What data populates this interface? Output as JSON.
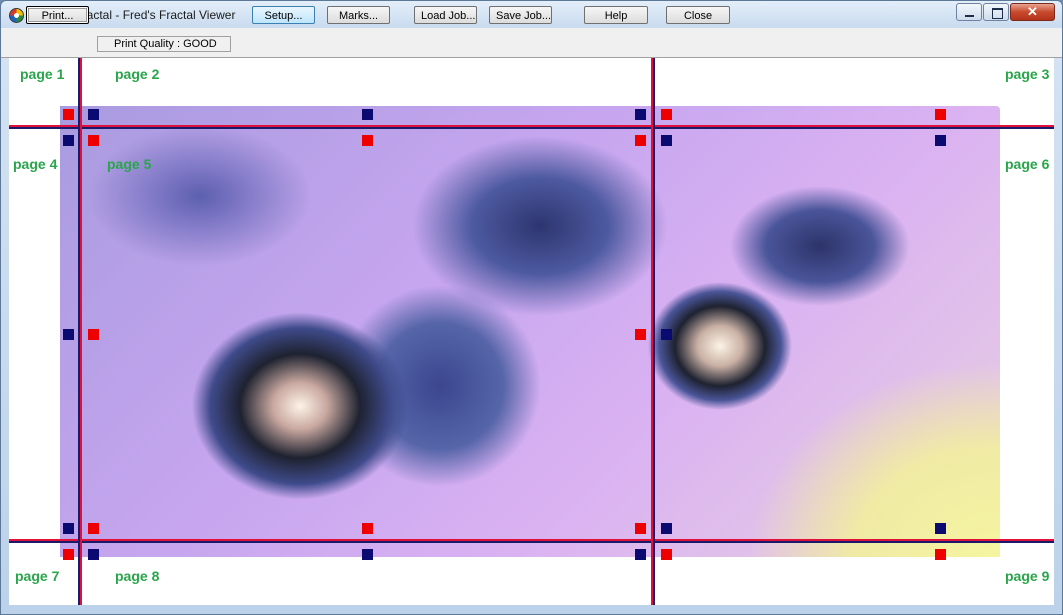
{
  "window": {
    "title": "emmaz.efractal - Fred's Fractal Viewer",
    "icon": "fractal-app-icon"
  },
  "toolbar": {
    "print_label": "Print...",
    "quality_text": "Print Quality : GOOD",
    "setup_label": "Setup...",
    "marks_label": "Marks...",
    "load_job_label": "Load Job...",
    "save_job_label": "Save Job...",
    "help_label": "Help",
    "close_label": "Close"
  },
  "pages": [
    {
      "label": "page 1"
    },
    {
      "label": "page 2"
    },
    {
      "label": "page 3"
    },
    {
      "label": "page 4"
    },
    {
      "label": "page 5"
    },
    {
      "label": "page 6"
    },
    {
      "label": "page 7"
    },
    {
      "label": "page 8"
    },
    {
      "label": "page 9"
    }
  ],
  "colors": {
    "page_label": "#2aa54b",
    "mark_red": "#ee0000",
    "mark_blue": "#0a0a70",
    "line_red": "#e0103a",
    "line_blue": "#1a1a6a"
  }
}
